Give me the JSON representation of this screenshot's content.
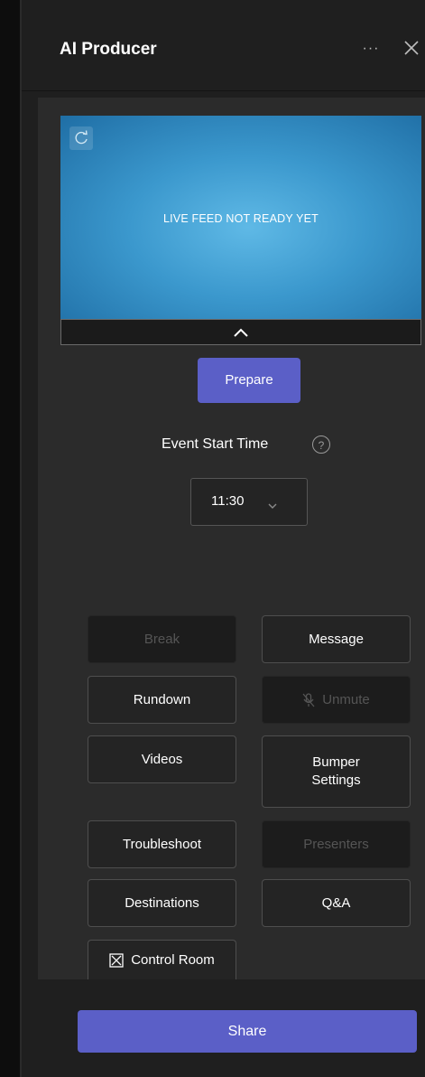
{
  "header": {
    "title": "AI Producer",
    "more_label": "···"
  },
  "preview": {
    "status_text": "LIVE FEED NOT READY YET"
  },
  "prepare_label": "Prepare",
  "event_start": {
    "label": "Event Start Time",
    "help": "?",
    "time_value": "11:30"
  },
  "actions": {
    "break": "Break",
    "message": "Message",
    "rundown": "Rundown",
    "unmute": "Unmute",
    "videos": "Videos",
    "bumper_settings_1": "Bumper",
    "bumper_settings_2": "Settings",
    "troubleshoot": "Troubleshoot",
    "presenters": "Presenters",
    "destinations": "Destinations",
    "qa": "Q&A",
    "control_room": "Control Room"
  },
  "share_label": "Share",
  "colors": {
    "accent": "#5b5fc7",
    "preview_blue": "#3b98cd",
    "panel_bg": "#1f1f1f",
    "content_bg": "#2b2b2b"
  },
  "icons": [
    "more-icon",
    "close-icon",
    "refresh-icon",
    "chevron-up-icon",
    "help-icon",
    "chevron-down-icon",
    "mic-off-icon",
    "expand-icon"
  ]
}
